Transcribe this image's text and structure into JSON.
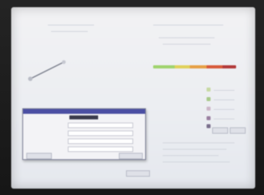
{
  "photo": {
    "note": "",
    "colors": {
      "bezel": "#1b1b1b",
      "screen": "#eceef2",
      "dialog_titlebar": "#4b4fa3",
      "dialog_tab": "#3b3b4d",
      "meter": [
        "#9fd36d",
        "#e0d15a",
        "#e6a045",
        "#d75a3a",
        "#b23a3a"
      ],
      "swatches": [
        "#c7d9a3",
        "#a8c98a",
        "#cdb7c9",
        "#9a7fa0",
        "#7a6f8c"
      ]
    }
  },
  "screen": {
    "header_left": {
      "title": "",
      "subtitle": ""
    },
    "header_right": {
      "title": "",
      "lines": [
        "",
        ""
      ]
    },
    "sidebar_right": {
      "items": [
        "",
        "",
        "",
        "",
        ""
      ]
    },
    "dialog": {
      "title": "",
      "tab_label": "",
      "rows": [
        {
          "label": "",
          "value": ""
        },
        {
          "label": "",
          "value": ""
        },
        {
          "label": "",
          "value": ""
        },
        {
          "label": "",
          "value": ""
        }
      ],
      "buttons": {
        "ok": "",
        "cancel": ""
      }
    },
    "bottom_buttons": {
      "left": "",
      "right": "",
      "far_right": ""
    },
    "chart_plot": {
      "point_label": ""
    }
  }
}
